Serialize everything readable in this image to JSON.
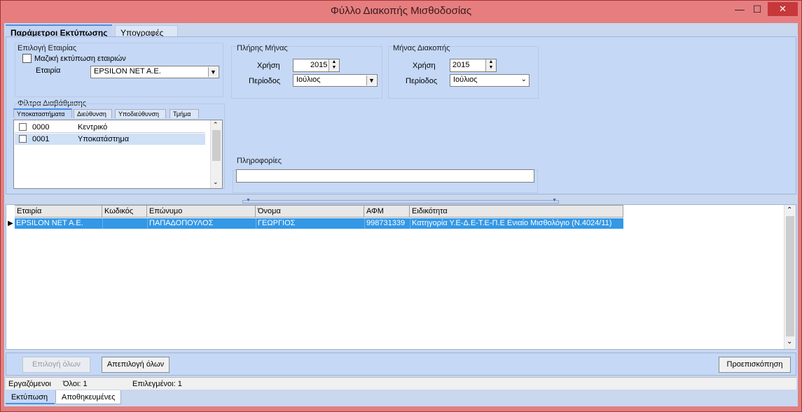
{
  "window": {
    "title": "Φύλλο Διακοπής Μισθοδοσίας",
    "minimize": "—",
    "maximize": "☐",
    "close": "✕"
  },
  "tabs": [
    "Παράμετροι Εκτύπωσης",
    "Υπογραφές"
  ],
  "company_group": {
    "label": "Επιλογή Εταιρίας",
    "mass_print_label": "Μαζική εκτύπωση εταιριών",
    "mass_print_checked": false,
    "company_label": "Εταιρία",
    "company_value": "EPSILON NET A.E."
  },
  "full_month": {
    "label": "Πλήρης Μήνας",
    "year_label": "Χρήση",
    "year_value": "2015",
    "period_label": "Περίοδος",
    "period_value": "Ιούλιος"
  },
  "stop_month": {
    "label": "Μήνας Διακοπής",
    "year_label": "Χρήση",
    "year_value": "2015",
    "period_label": "Περίοδος",
    "period_value": "Ιούλιος"
  },
  "filters": {
    "label": "Φίλτρα Διαβάθμισης",
    "tabs": [
      "Υποκαταστήματα",
      "Διεύθυνση",
      "Υποδιεύθυνση",
      "Τμήμα"
    ],
    "items": [
      {
        "code": "0000",
        "name": "Κεντρικό",
        "checked": false
      },
      {
        "code": "0001",
        "name": "Υποκατάστημα",
        "checked": false
      }
    ]
  },
  "info": {
    "label": "Πληροφορίες",
    "value": ""
  },
  "grid": {
    "columns": [
      "Εταιρία",
      "Κωδικός",
      "Επώνυμο",
      "Όνομα",
      "ΑΦΜ",
      "Ειδικότητα"
    ],
    "rows": [
      [
        "EPSILON NET A.E.",
        "",
        "ΠΑΠΑΔΟΠΟΥΛΟΣ",
        "ΓΕΩΡΓΙΟΣ",
        "998731339",
        "Κατηγορία Υ.Ε-Δ.Ε-Τ.Ε-Π.Ε Ενιαίο Μισθολόγιο (Ν.4024/11)"
      ]
    ],
    "row_indicator": "▶"
  },
  "buttons": {
    "select_all": "Επιλογή όλων",
    "deselect_all": "Απεπιλογή όλων",
    "preview": "Προεπισκόπηση"
  },
  "status": {
    "employees": "Εργαζόμενοι",
    "total": "Όλοι: 1",
    "selected": "Επιλεγμένοι: 1"
  },
  "bottom_tabs": [
    "Εκτύπωση",
    "Αποθηκευμένες"
  ],
  "colors": {
    "titlebar": "#e67e80",
    "panel": "#c5d8f6",
    "selection": "#3398e6",
    "accent": "#4d8ee4"
  }
}
